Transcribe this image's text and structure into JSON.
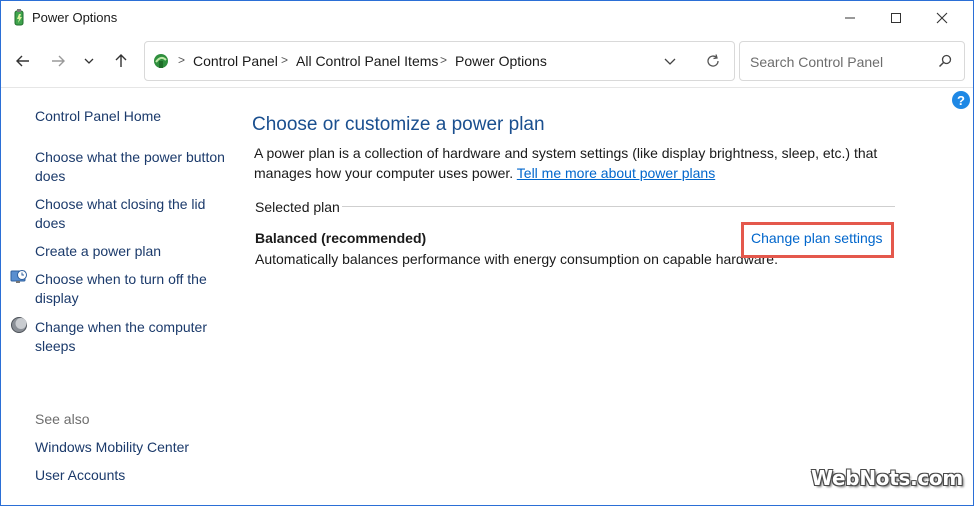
{
  "window": {
    "title": "Power Options"
  },
  "address_bar": {
    "breadcrumbs": [
      "Control Panel",
      "All Control Panel Items",
      "Power Options"
    ],
    "search_placeholder": "Search Control Panel"
  },
  "help": {
    "label": "?"
  },
  "sidebar": {
    "home": "Control Panel Home",
    "links": [
      {
        "label": "Choose what the power button does"
      },
      {
        "label": "Choose what closing the lid does"
      },
      {
        "label": "Create a power plan"
      },
      {
        "label": "Choose when to turn off the display",
        "icon": "display-clock-icon"
      },
      {
        "label": "Change when the computer sleeps",
        "icon": "moon-icon"
      }
    ],
    "see_also_heading": "See also",
    "see_also": [
      "Windows Mobility Center",
      "User Accounts"
    ]
  },
  "main": {
    "heading": "Choose or customize a power plan",
    "description": "A power plan is a collection of hardware and system settings (like display brightness, sleep, etc.) that manages how your computer uses power.",
    "learn_more_link": "Tell me more about power plans",
    "section_label": "Selected plan",
    "plan_name": "Balanced (recommended)",
    "plan_description": "Automatically balances performance with energy consumption on capable hardware.",
    "change_settings_link": "Change plan settings"
  },
  "watermark": "WebNots.com",
  "colors": {
    "accent": "#0066cc",
    "heading": "#1a4f8f",
    "highlight": "#e4584c"
  }
}
